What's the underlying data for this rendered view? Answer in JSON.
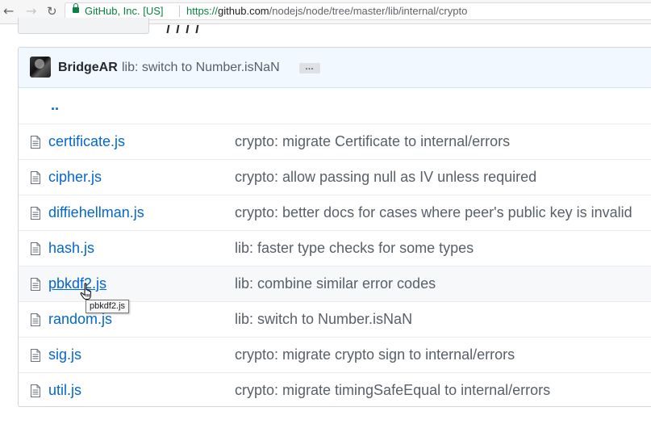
{
  "browser": {
    "back_icon": "arrow-left-icon",
    "forward_icon": "arrow-right-icon",
    "reload_icon": "reload-icon",
    "lock_icon": "lock-icon",
    "secure_label": "GitHub, Inc. [US]",
    "url_protocol": "https://",
    "url_host": "github.com",
    "url_path": "/nodejs/node/tree/master/lib/internal/crypto"
  },
  "commit": {
    "author": "BridgeAR",
    "message": "lib: switch to Number.isNaN",
    "ellipsis": "…",
    "accent_bg": "#f1f8ff"
  },
  "up_dir": {
    "label": ".."
  },
  "files": [
    {
      "name": "certificate.js",
      "message": "crypto: migrate Certificate to internal/errors"
    },
    {
      "name": "cipher.js",
      "message": "crypto: allow passing null as IV unless required"
    },
    {
      "name": "diffiehellman.js",
      "message": "crypto: better docs for cases where peer's public key is invalid"
    },
    {
      "name": "hash.js",
      "message": "lib: faster type checks for some types"
    },
    {
      "name": "pbkdf2.js",
      "message": "lib: combine similar error codes"
    },
    {
      "name": "random.js",
      "message": "lib: switch to Number.isNaN"
    },
    {
      "name": "sig.js",
      "message": "crypto: migrate crypto sign to internal/errors"
    },
    {
      "name": "util.js",
      "message": "crypto: migrate timingSafeEqual to internal/errors"
    }
  ],
  "tooltip": {
    "text": "pbkdf2.js"
  },
  "colors": {
    "link": "#0366d6",
    "muted": "#586069",
    "secure_green": "#0b8043"
  }
}
